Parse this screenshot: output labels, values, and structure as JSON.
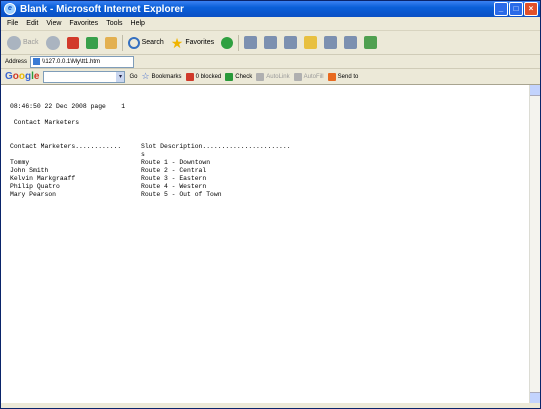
{
  "window": {
    "title": "Blank - Microsoft Internet Explorer"
  },
  "menu": [
    "File",
    "Edit",
    "View",
    "Favorites",
    "Tools",
    "Help"
  ],
  "toolbar": {
    "back": "Back",
    "search": "Search",
    "favorites": "Favorites"
  },
  "address": {
    "label": "Address",
    "value": "\\\\127.0.0.1\\My\\tt1.htm"
  },
  "google": {
    "logo": "Google",
    "go": "Go",
    "bookmarks": "Bookmarks",
    "blocked": "0 blocked",
    "check": "Check",
    "autolink": "AutoLink",
    "autofill": "AutoFill",
    "send_to": "Send to"
  },
  "report": {
    "header_line": "08:46:50 22 Dec 2008 page    1",
    "title": "Contact Marketers",
    "col1_header": "Contact Marketers............",
    "col2_header": "Slot Description.......................",
    "col2_header_cont": "s",
    "rows": [
      {
        "contact": "Tommy",
        "slot": "Route 1 - Downtown"
      },
      {
        "contact": "John Smith",
        "slot": "Route 2 - Central"
      },
      {
        "contact": "Kelvin Markgraaff",
        "slot": "Route 3 - Eastern"
      },
      {
        "contact": "Philip Quatro",
        "slot": "Route 4 - Western"
      },
      {
        "contact": "Mary Pearson",
        "slot": "Route 5 - Out of Town"
      }
    ]
  }
}
